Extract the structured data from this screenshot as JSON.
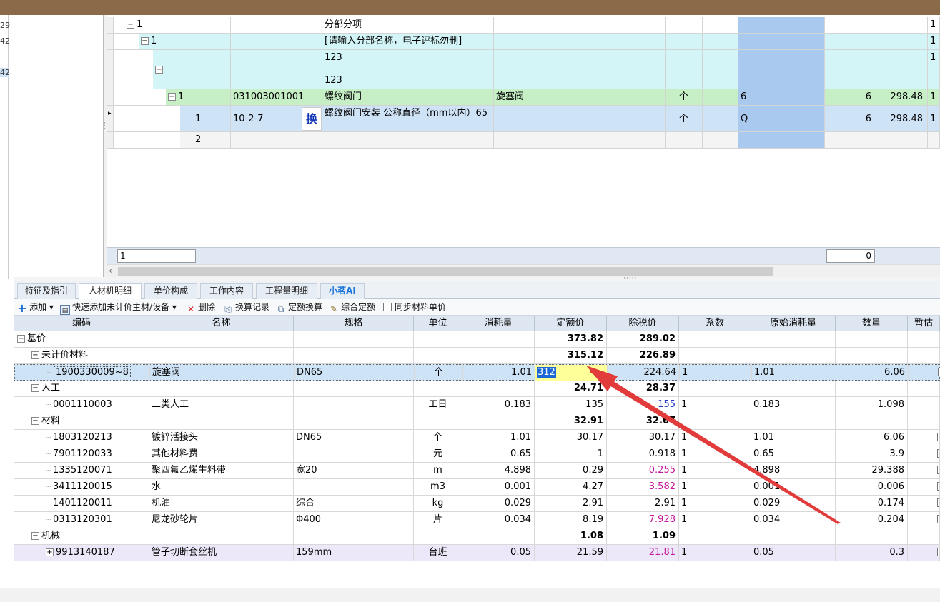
{
  "left_numbers": [
    "29",
    "42",
    "42"
  ],
  "upper_rows": [
    {
      "indent_label": "1",
      "code": "",
      "name": "分部分项",
      "spec": "",
      "unit": "",
      "qty_expr": "",
      "qty": "",
      "price": "",
      "extra": "1",
      "type": "section"
    },
    {
      "indent_label": "1",
      "code": "",
      "name": "[请输入分部名称，电子评标勿删]",
      "spec": "",
      "unit": "",
      "qty_expr": "",
      "qty": "",
      "price": "",
      "extra": "1",
      "type": "sub"
    },
    {
      "indent_label": "",
      "code": "",
      "name": "123",
      "name2": "123",
      "spec": "",
      "unit": "",
      "qty_expr": "",
      "qty": "",
      "price": "",
      "extra": "1",
      "type": "sub2"
    },
    {
      "indent_label": "1",
      "code": "031003001001",
      "name": "螺纹阀门",
      "spec": "旋塞阀",
      "unit": "个",
      "qty_expr": "6",
      "qty": "6",
      "price": "298.48",
      "extra": "1",
      "type": "item"
    },
    {
      "indent_label": "1",
      "code": "10-2-7",
      "badge": "换",
      "name": "螺纹阀门安装 公称直径（mm以内）65",
      "spec": "",
      "unit": "个",
      "qty_expr": "Q",
      "qty": "6",
      "price": "298.48",
      "extra": "1",
      "type": "quota"
    },
    {
      "indent_label": "2",
      "code": "",
      "name": "",
      "spec": "",
      "unit": "",
      "qty_expr": "",
      "qty": "",
      "price": "",
      "extra": "",
      "type": "empty"
    }
  ],
  "upper_footer": {
    "left_value": "1",
    "right_value": "0"
  },
  "tabs": [
    "特征及指引",
    "人材机明细",
    "单价构成",
    "工作内容",
    "工程量明细",
    "小茗AI"
  ],
  "toolbar": {
    "add": "添加",
    "quick_add": "快速添加未计价主材/设备",
    "delete": "删除",
    "history": "换算记录",
    "quota_convert": "定额换算",
    "composite": "综合定额",
    "sync": "同步材料单价"
  },
  "columns": [
    "编码",
    "名称",
    "规格",
    "单位",
    "消耗量",
    "定额价",
    "除税价",
    "系数",
    "原始消耗量",
    "数量",
    "暂估"
  ],
  "rows": [
    {
      "level": 0,
      "toggle": "−",
      "code": "基价",
      "name": "",
      "spec": "",
      "unit": "",
      "consume": "",
      "quota": "373.82",
      "tax": "289.02",
      "coef": "",
      "orig": "",
      "qty": "",
      "group": true
    },
    {
      "level": 1,
      "toggle": "−",
      "code": "未计价材料",
      "name": "",
      "spec": "",
      "unit": "",
      "consume": "",
      "quota": "315.12",
      "tax": "226.89",
      "coef": "",
      "orig": "",
      "qty": "",
      "group": true
    },
    {
      "level": 2,
      "toggle": "",
      "code": "1900330009~8",
      "name": "旋塞阀",
      "spec": "DN65",
      "unit": "个",
      "consume": "1.01",
      "quota": "312",
      "tax": "224.64",
      "coef": "1",
      "orig": "1.01",
      "qty": "6.06",
      "selected": true
    },
    {
      "level": 1,
      "toggle": "−",
      "code": "人工",
      "name": "",
      "spec": "",
      "unit": "",
      "consume": "",
      "quota": "24.71",
      "tax": "28.37",
      "coef": "",
      "orig": "",
      "qty": "",
      "group": true
    },
    {
      "level": 2,
      "toggle": "",
      "code": "0001110003",
      "name": "二类人工",
      "spec": "",
      "unit": "工日",
      "consume": "0.183",
      "quota": "135",
      "tax": "155",
      "coef": "1",
      "orig": "0.183",
      "qty": "1.098",
      "taxColor": "blue"
    },
    {
      "level": 1,
      "toggle": "−",
      "code": "材料",
      "name": "",
      "spec": "",
      "unit": "",
      "consume": "",
      "quota": "32.91",
      "tax": "32.67",
      "coef": "",
      "orig": "",
      "qty": "",
      "group": true
    },
    {
      "level": 2,
      "toggle": "",
      "code": "1803120213",
      "name": "镀锌活接头",
      "spec": "DN65",
      "unit": "个",
      "consume": "1.01",
      "quota": "30.17",
      "tax": "30.17",
      "coef": "1",
      "orig": "1.01",
      "qty": "6.06"
    },
    {
      "level": 2,
      "toggle": "",
      "code": "7901120033",
      "name": "其他材料费",
      "spec": "",
      "unit": "元",
      "consume": "0.65",
      "quota": "1",
      "tax": "0.918",
      "coef": "1",
      "orig": "0.65",
      "qty": "3.9"
    },
    {
      "level": 2,
      "toggle": "",
      "code": "1335120071",
      "name": "聚四氟乙烯生料带",
      "spec": "宽20",
      "unit": "m",
      "consume": "4.898",
      "quota": "0.29",
      "tax": "0.255",
      "coef": "1",
      "orig": "4.898",
      "qty": "29.388",
      "taxColor": "pink"
    },
    {
      "level": 2,
      "toggle": "",
      "code": "3411120015",
      "name": "水",
      "spec": "",
      "unit": "m3",
      "consume": "0.001",
      "quota": "4.27",
      "tax": "3.582",
      "coef": "1",
      "orig": "0.001",
      "qty": "0.006",
      "taxColor": "pink"
    },
    {
      "level": 2,
      "toggle": "",
      "code": "1401120011",
      "name": "机油",
      "spec": "综合",
      "unit": "kg",
      "consume": "0.029",
      "quota": "2.91",
      "tax": "2.91",
      "coef": "1",
      "orig": "0.029",
      "qty": "0.174"
    },
    {
      "level": 2,
      "toggle": "",
      "code": "0313120301",
      "name": "尼龙砂轮片",
      "spec": "Φ400",
      "unit": "片",
      "consume": "0.034",
      "quota": "8.19",
      "tax": "7.928",
      "coef": "1",
      "orig": "0.034",
      "qty": "0.204",
      "taxColor": "pink"
    },
    {
      "level": 1,
      "toggle": "−",
      "code": "机械",
      "name": "",
      "spec": "",
      "unit": "",
      "consume": "",
      "quota": "1.08",
      "tax": "1.09",
      "coef": "",
      "orig": "",
      "qty": "",
      "group": true
    },
    {
      "level": 2,
      "toggle": "+",
      "code": "9913140187",
      "name": "管子切断套丝机",
      "spec": "159mm",
      "unit": "台班",
      "consume": "0.05",
      "quota": "21.59",
      "tax": "21.81",
      "coef": "1",
      "orig": "0.05",
      "qty": "0.3",
      "taxColor": "pink",
      "machine": true
    }
  ],
  "colors": {
    "accent": "#e23b3b",
    "selection": "#cfe3f7",
    "edit": "#ffff99",
    "group_item": "#c6efc6",
    "sub_section": "#d3f5f8",
    "machine_row": "#ece8f9"
  }
}
